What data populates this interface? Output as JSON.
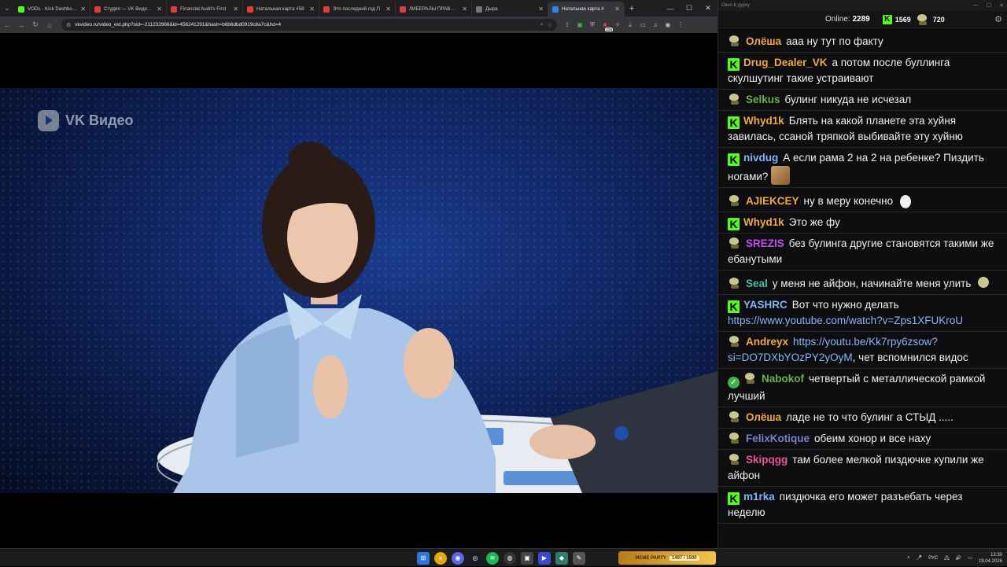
{
  "browser": {
    "tabs": [
      {
        "title": "VODs - Kick Dashboard",
        "color": "#53fc18",
        "active": false
      },
      {
        "title": "Студия — VK Видео Li",
        "color": "#e23b3b",
        "active": false
      },
      {
        "title": "Financial Audit's First",
        "color": "#e23b3b",
        "active": false
      },
      {
        "title": "Натальная карта #58",
        "color": "#e23b3b",
        "active": false
      },
      {
        "title": "Это последний год П",
        "color": "#e23b3b",
        "active": false
      },
      {
        "title": "ЛИБЕРАЛЫ ПРАВЫ В",
        "color": "#e23b3b",
        "active": false
      },
      {
        "title": "Дыра",
        "color": "#777777",
        "active": false
      },
      {
        "title": "Натальная карта #",
        "color": "#2787f5",
        "active": true
      }
    ],
    "url": "vkvideo.ru/video_ext.php?oid=-211232966&id=456241291&hash=b6b6dbd0919c8a7c&hd=4",
    "ext_badge": "228"
  },
  "video": {
    "logo_text": "VK Видео"
  },
  "chat": {
    "window_title": "Окно в дурку",
    "online_label": "Online:",
    "online_count": "2289",
    "kick_count": "1569",
    "sub_count": "720",
    "messages": [
      {
        "badge": "sub",
        "user": "Олёша",
        "color": "#f2a93b",
        "text": "ааа ну тут по факту"
      },
      {
        "badge": "kick",
        "user": "Drug_Dealer_VK",
        "color": "#f2a93b",
        "text": "а потом после буллинга скулшутинг такие устраивают"
      },
      {
        "badge": "sub",
        "user": "Selkus",
        "color": "#6ab04c",
        "text": "булинг никуда не исчезал"
      },
      {
        "badge": "kick",
        "user": "Whyd1k",
        "color": "#f2a93b",
        "text": "Блять на какой планете эта хуйня завилась, ссаной тряпкой выбивайте эту хуйню"
      },
      {
        "badge": "kick",
        "user": "nivdug",
        "color": "#7fb3ff",
        "text": "А если рама 2 на 2 на ребенке? Пиздить ногами?",
        "emote": "cat"
      },
      {
        "badge": "sub",
        "user": "AJIEKCEY",
        "color": "#f2a93b",
        "text": "ну в меру конечно",
        "emote": "hat"
      },
      {
        "badge": "kick",
        "user": "Whyd1k",
        "color": "#f2a93b",
        "text": "Это же фу"
      },
      {
        "badge": "sub",
        "user": "SREZIS",
        "color": "#c44cf0",
        "text": "без булинга другие становятся такими же ебанутыми"
      },
      {
        "badge": "sub",
        "user": "Seal",
        "color": "#3fbfa0",
        "text": "у меня не айфон, начинайте меня улить",
        "emote": "pepe"
      },
      {
        "badge": "kick",
        "user": "YASHRC",
        "color": "#7fb3ff",
        "text": "Вот что нужно делать",
        "link": "https://www.youtube.com/watch?v=Zps1XFUKroU"
      },
      {
        "badge": "sub",
        "user": "Andreyx",
        "color": "#f2a93b",
        "link": "https://youtu.be/Kk7rpy6zsow?si=DO7DXbYOzPY2yOyM",
        "text": ", чет вспомнился видос"
      },
      {
        "badge": "check-sub",
        "user": "Nabokof",
        "color": "#6ab04c",
        "text": "четвертый с металлической рамкой лучший"
      },
      {
        "badge": "sub",
        "user": "Олёша",
        "color": "#f2a93b",
        "text": "ладе не то что булинг а СТЫД ....."
      },
      {
        "badge": "sub",
        "user": "FelixKotique",
        "color": "#7a7fd4",
        "text": "обеим хонор и все наху"
      },
      {
        "badge": "sub",
        "user": "Skipqgg",
        "color": "#e8559a",
        "text": "там более мелкой пиздючке купили же айфон"
      },
      {
        "badge": "kick",
        "user": "m1rka",
        "color": "#7fb3ff",
        "text": "пиздючка его может разъебать через неделю"
      }
    ]
  },
  "taskbar": {
    "widget_title": "MEME PARTY",
    "widget_value": "1497 / 1500",
    "lang": "РУС",
    "time": "13:30",
    "date": "19.04.2026"
  }
}
